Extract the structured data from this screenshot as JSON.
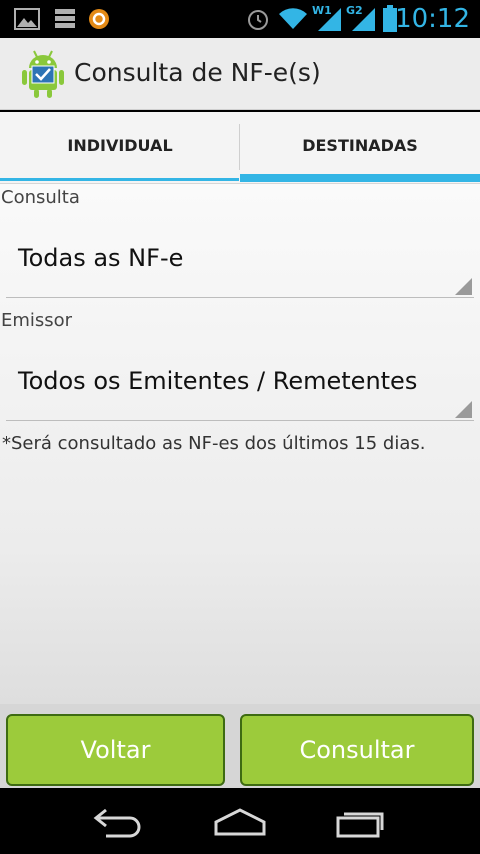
{
  "status_bar": {
    "time": "10:12",
    "icons": [
      "gallery-icon",
      "storage-icon",
      "avast-icon",
      "alarm-icon",
      "wifi-icon",
      "signal-w1-icon",
      "signal-g2-icon",
      "battery-icon"
    ],
    "signal_labels": {
      "w1": "W1",
      "g2": "G2"
    }
  },
  "action_bar": {
    "title": "Consulta de NF-e(s)",
    "icon": "android-app-icon"
  },
  "tabs": [
    {
      "label": "INDIVIDUAL",
      "selected": false
    },
    {
      "label": "DESTINADAS",
      "selected": true
    }
  ],
  "form": {
    "consulta_label": "Consulta",
    "consulta_value": "Todas as NF-e",
    "emissor_label": "Emissor",
    "emissor_value": "Todos os Emitentes / Remetentes",
    "note": "*Será consultado as NF-es dos últimos 15 dias."
  },
  "buttons": {
    "back_label": "Voltar",
    "submit_label": "Consultar"
  },
  "nav": {
    "icons": [
      "back-icon",
      "home-icon",
      "recent-apps-icon"
    ]
  },
  "colors": {
    "accent": "#33b5e5",
    "button_green": "#9ccb3b"
  }
}
